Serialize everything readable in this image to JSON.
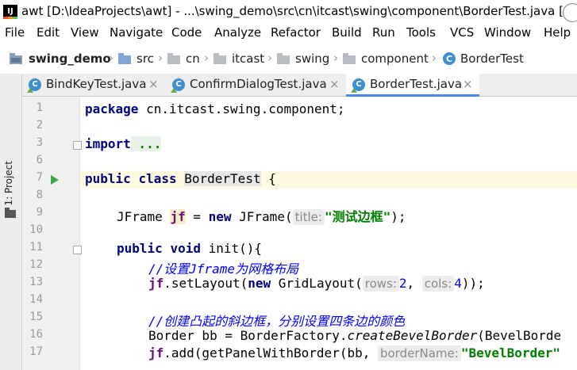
{
  "window": {
    "title": "awt [D:\\IdeaProjects\\awt] - ...\\swing_demo\\src\\cn\\itcast\\swing\\component\\BorderTest.java [swing"
  },
  "menu": [
    "File",
    "Edit",
    "View",
    "Navigate",
    "Code",
    "Analyze",
    "Refactor",
    "Build",
    "Run",
    "Tools",
    "VCS",
    "Window",
    "Help"
  ],
  "breadcrumb": [
    "swing_demo",
    "src",
    "cn",
    "itcast",
    "swing",
    "component",
    "BorderTest"
  ],
  "tabs": [
    {
      "label": "BindKeyTest.java",
      "close": "×"
    },
    {
      "label": "ConfirmDialogTest.java",
      "close": "×"
    },
    {
      "label": "BorderTest.java",
      "close": "×"
    }
  ],
  "sidebar": {
    "project_label": "1: Project"
  },
  "code": {
    "line_numbers": [
      "1",
      "2",
      "3",
      "6",
      "7",
      "8",
      "9",
      "10",
      "11",
      "12",
      "13",
      "14",
      "15",
      "16",
      "17"
    ],
    "l1_kw": "package",
    "l1_rest": " cn.itcast.swing.component;",
    "l3_kw": "import",
    "l3_fold": " ...",
    "l7_kw1": "public",
    "l7_kw2": "class",
    "l7_cls": "BorderTest",
    "l7_rest": " {",
    "l9_type": "JFrame ",
    "l9_var": "jf",
    "l9_eq": "  = ",
    "l9_new": "new",
    "l9_call": " JFrame(",
    "l9_hint": "title:",
    "l9_str": "\"测试边框\"",
    "l9_end": ");",
    "l11_kw1": "public",
    "l11_kw2": "void",
    "l11_rest": " init(){",
    "l12_cmt": "//设置Jframe为网格布局",
    "l13_var": "jf",
    "l13_call": ".setLayout(",
    "l13_new": "new",
    "l13_cls": " GridLayout(",
    "l13_hint1": "rows:",
    "l13_num1": "2",
    "l13_comma": ", ",
    "l13_hint2": "cols:",
    "l13_num2": "4",
    "l13_end": "));",
    "l15_cmt": "//创建凸起的斜边框，分别设置四条边的颜色",
    "l16_pre": "Border bb = BorderFactory.",
    "l16_mth": "createBevelBorder",
    "l16_post": "(BevelBorde",
    "l17_var": "jf",
    "l17_call": ".add(getPanelWithBorder(bb, ",
    "l17_hint": "borderName:",
    "l17_str": "\"BevelBorder\""
  }
}
